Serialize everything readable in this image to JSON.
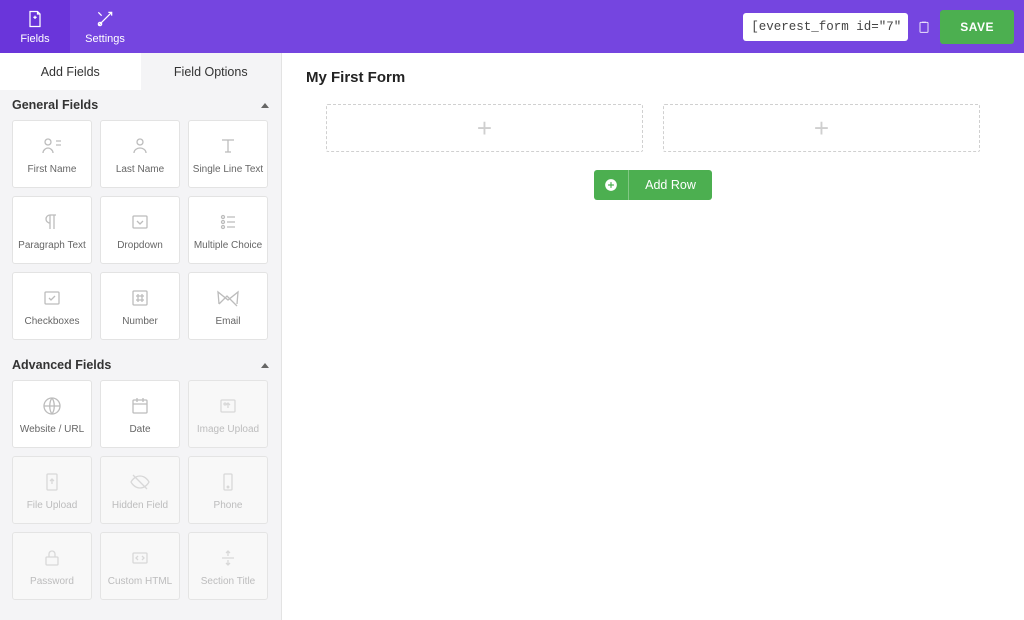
{
  "topbar": {
    "fields_label": "Fields",
    "settings_label": "Settings",
    "shortcode": "[everest_form id=\"7\"]",
    "save_label": "SAVE"
  },
  "sidebar": {
    "tab_add_fields": "Add Fields",
    "tab_field_options": "Field Options",
    "general": {
      "title": "General Fields",
      "items": [
        {
          "id": "first-name",
          "label": "First Name",
          "disabled": false
        },
        {
          "id": "last-name",
          "label": "Last Name",
          "disabled": false
        },
        {
          "id": "single-line-text",
          "label": "Single Line Text",
          "disabled": false
        },
        {
          "id": "paragraph-text",
          "label": "Paragraph Text",
          "disabled": false
        },
        {
          "id": "dropdown",
          "label": "Dropdown",
          "disabled": false
        },
        {
          "id": "multiple-choice",
          "label": "Multiple Choice",
          "disabled": false
        },
        {
          "id": "checkboxes",
          "label": "Checkboxes",
          "disabled": false
        },
        {
          "id": "number",
          "label": "Number",
          "disabled": false
        },
        {
          "id": "email",
          "label": "Email",
          "disabled": false
        }
      ]
    },
    "advanced": {
      "title": "Advanced Fields",
      "items": [
        {
          "id": "website-url",
          "label": "Website / URL",
          "disabled": false
        },
        {
          "id": "date",
          "label": "Date",
          "disabled": false
        },
        {
          "id": "image-upload",
          "label": "Image Upload",
          "disabled": true
        },
        {
          "id": "file-upload",
          "label": "File Upload",
          "disabled": true
        },
        {
          "id": "hidden-field",
          "label": "Hidden Field",
          "disabled": true
        },
        {
          "id": "phone",
          "label": "Phone",
          "disabled": true
        },
        {
          "id": "password",
          "label": "Password",
          "disabled": true
        },
        {
          "id": "custom-html",
          "label": "Custom HTML",
          "disabled": true
        },
        {
          "id": "section-title",
          "label": "Section Title",
          "disabled": true
        }
      ]
    }
  },
  "canvas": {
    "form_title": "My First Form",
    "add_row_label": "Add Row"
  }
}
